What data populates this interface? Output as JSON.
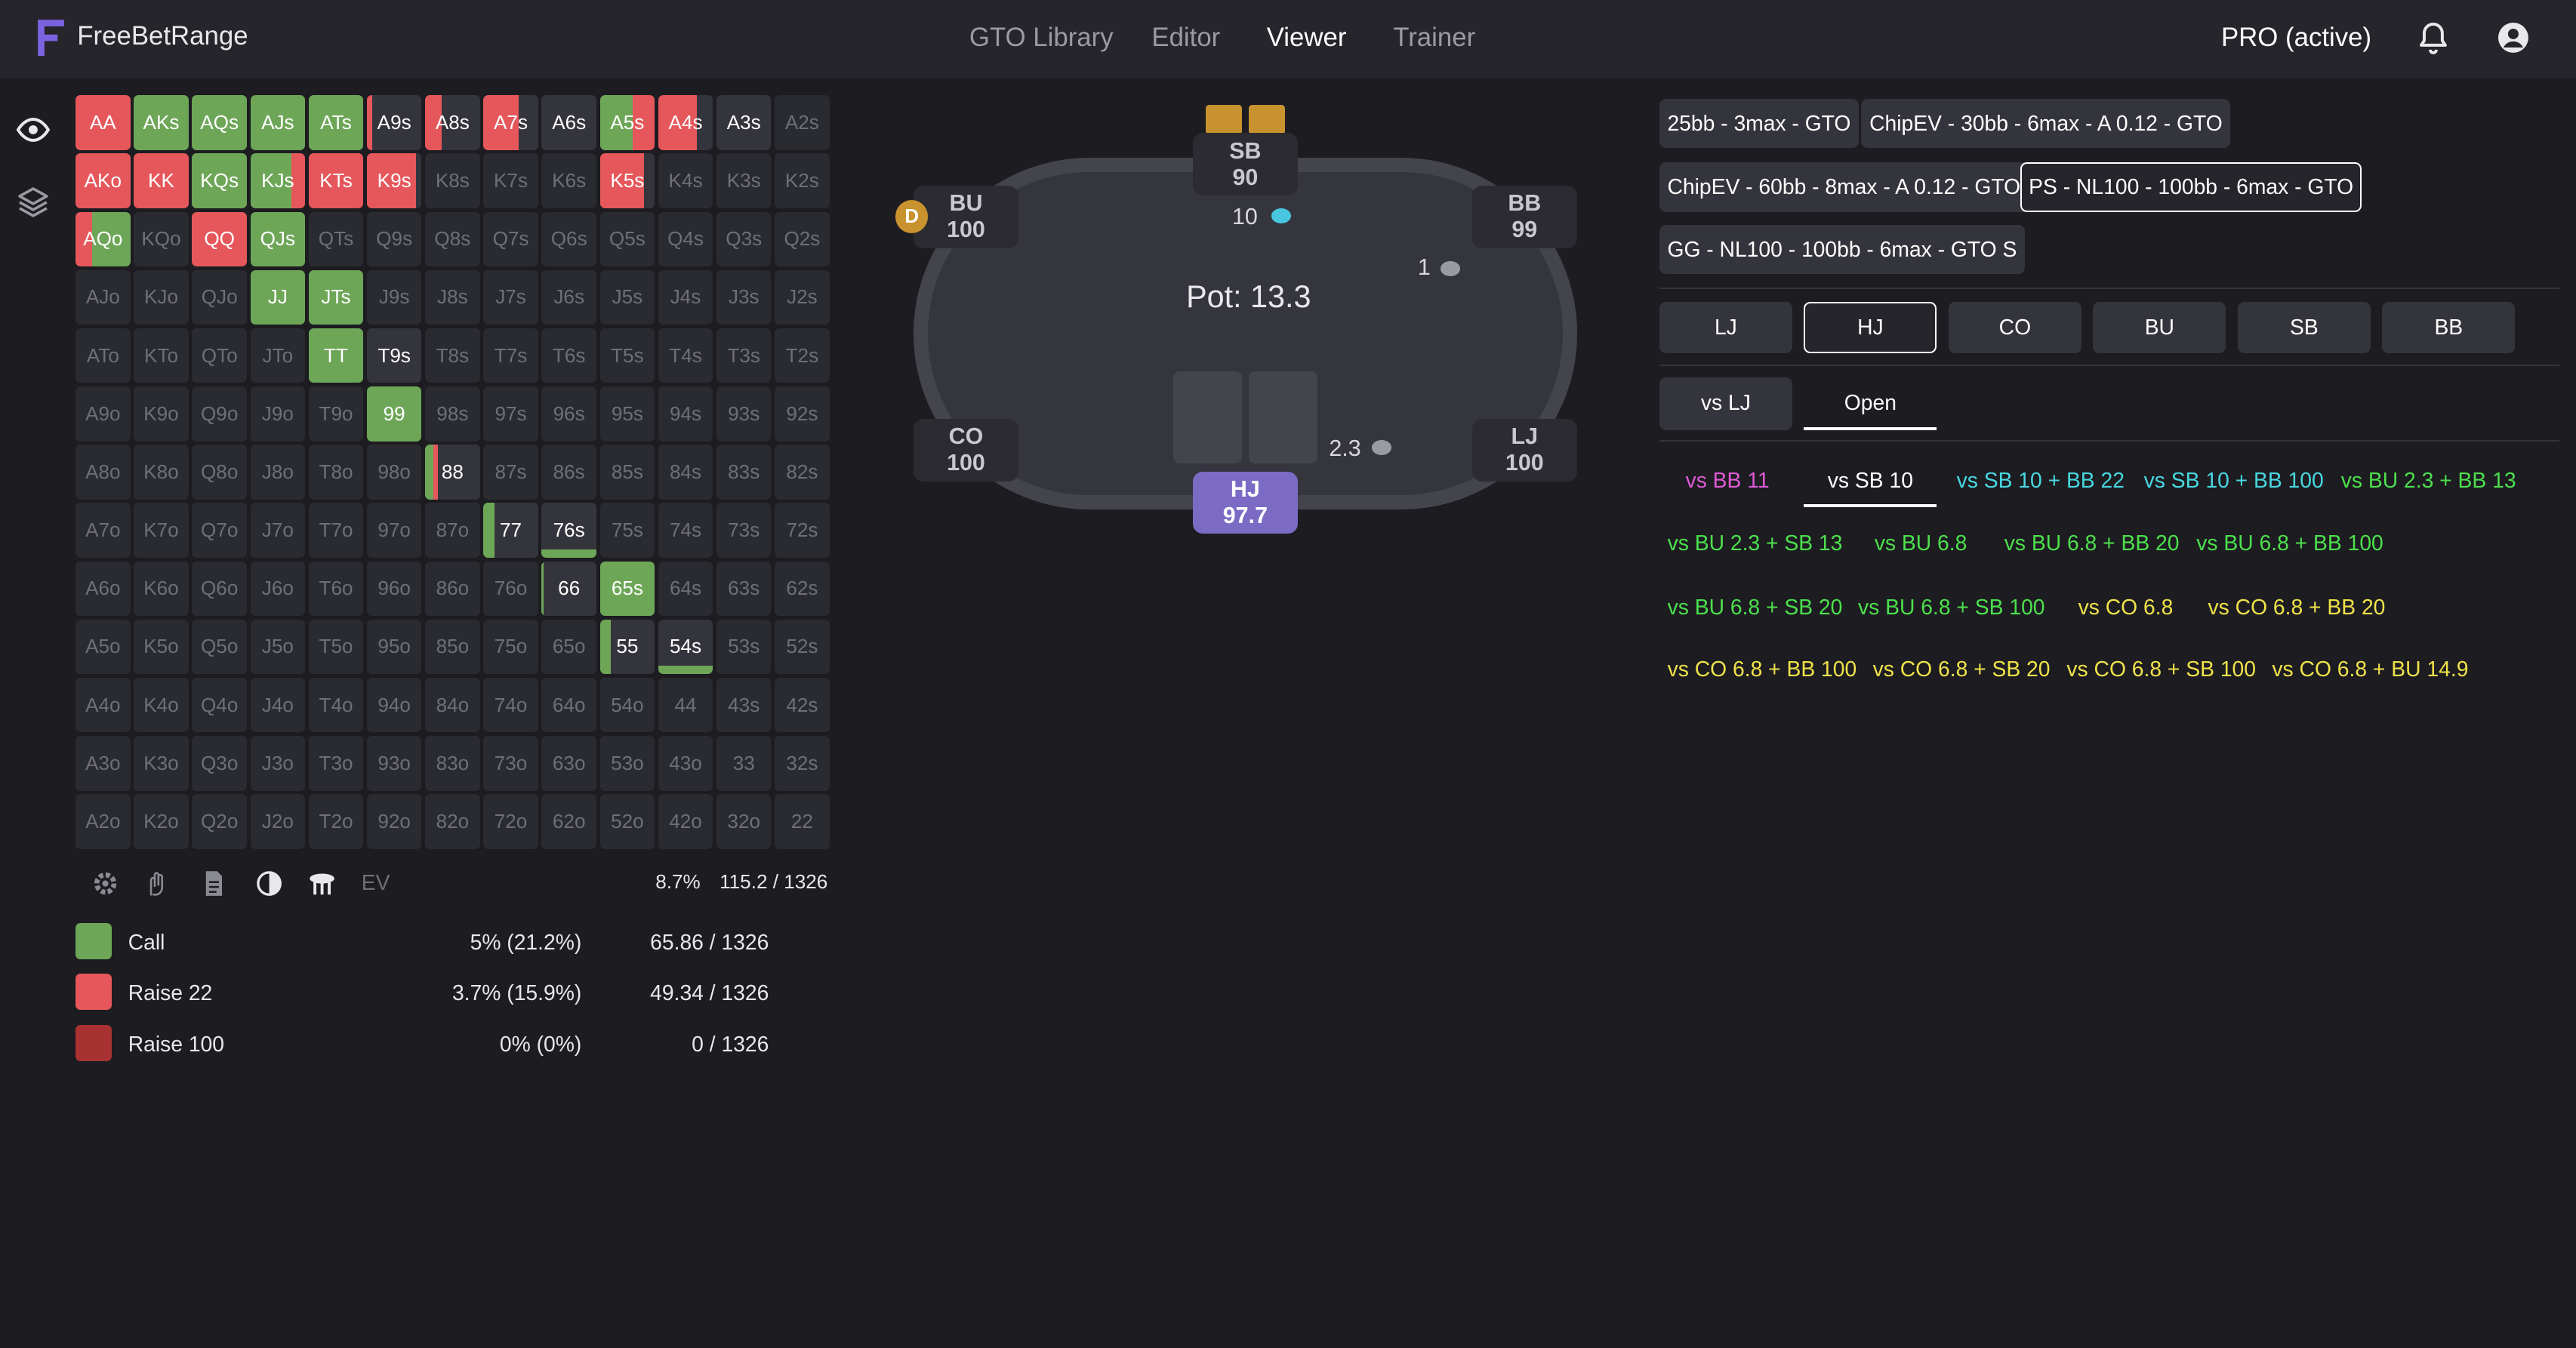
{
  "header": {
    "brand": "FreeBetRange",
    "nav": [
      "GTO Library",
      "Editor",
      "Viewer",
      "Trainer"
    ],
    "active_nav": "Viewer",
    "pro_status": "PRO (active)"
  },
  "rail": [
    "eye-icon",
    "layers-icon"
  ],
  "colors": {
    "call": "#6ea658",
    "raise22": "#e5575b",
    "raise100": "#a83232",
    "hero": "#7b6bc4",
    "dealer": "#c8922f"
  },
  "grid": [
    [
      [
        "AA",
        "mix",
        "raise22:1"
      ],
      [
        "AKs",
        "mix",
        "call:1"
      ],
      [
        "AQs",
        "mix",
        "call:1"
      ],
      [
        "AJs",
        "mix",
        "call:1"
      ],
      [
        "ATs",
        "mix",
        "call:1"
      ],
      [
        "A9s",
        "mix",
        "raise22:0.1,dark:0.9"
      ],
      [
        "A8s",
        "mix",
        "raise22:0.3,dark:0.7"
      ],
      [
        "A7s",
        "mix",
        "raise22:0.65,dark:0.35"
      ],
      [
        "A6s",
        "mix",
        "dark:1"
      ],
      [
        "A5s",
        "mix",
        "call:0.6,raise22:0.4"
      ],
      [
        "A4s",
        "mix",
        "raise22:0.7,dark:0.3"
      ],
      [
        "A3s",
        "mix",
        "dark:1"
      ],
      [
        "A2s",
        "off",
        ""
      ]
    ],
    [
      [
        "AKo",
        "mix",
        "raise22:1"
      ],
      [
        "KK",
        "mix",
        "raise22:1"
      ],
      [
        "KQs",
        "mix",
        "call:1"
      ],
      [
        "KJs",
        "mix",
        "call:0.75,raise22:0.25"
      ],
      [
        "KTs",
        "mix",
        "raise22:1"
      ],
      [
        "K9s",
        "mix",
        "raise22:0.9,dark:0.1"
      ],
      [
        "K8s",
        "off",
        ""
      ],
      [
        "K7s",
        "off",
        ""
      ],
      [
        "K6s",
        "off",
        ""
      ],
      [
        "K5s",
        "mix",
        "raise22:0.8,dark:0.2"
      ],
      [
        "K4s",
        "off",
        ""
      ],
      [
        "K3s",
        "off",
        ""
      ],
      [
        "K2s",
        "off",
        ""
      ]
    ],
    [
      [
        "AQo",
        "mix",
        "raise22:0.3,call:0.7"
      ],
      [
        "KQo",
        "off",
        ""
      ],
      [
        "QQ",
        "mix",
        "raise22:1"
      ],
      [
        "QJs",
        "mix",
        "call:1"
      ],
      [
        "QTs",
        "off",
        ""
      ],
      [
        "Q9s",
        "off",
        ""
      ],
      [
        "Q8s",
        "off",
        ""
      ],
      [
        "Q7s",
        "off",
        ""
      ],
      [
        "Q6s",
        "off",
        ""
      ],
      [
        "Q5s",
        "off",
        ""
      ],
      [
        "Q4s",
        "off",
        ""
      ],
      [
        "Q3s",
        "off",
        ""
      ],
      [
        "Q2s",
        "off",
        ""
      ]
    ],
    [
      [
        "AJo",
        "off",
        ""
      ],
      [
        "KJo",
        "off",
        ""
      ],
      [
        "QJo",
        "off",
        ""
      ],
      [
        "JJ",
        "mix",
        "call:1"
      ],
      [
        "JTs",
        "mix",
        "call:1"
      ],
      [
        "J9s",
        "off",
        ""
      ],
      [
        "J8s",
        "off",
        ""
      ],
      [
        "J7s",
        "off",
        ""
      ],
      [
        "J6s",
        "off",
        ""
      ],
      [
        "J5s",
        "off",
        ""
      ],
      [
        "J4s",
        "off",
        ""
      ],
      [
        "J3s",
        "off",
        ""
      ],
      [
        "J2s",
        "off",
        ""
      ]
    ],
    [
      [
        "ATo",
        "off",
        ""
      ],
      [
        "KTo",
        "off",
        ""
      ],
      [
        "QTo",
        "off",
        ""
      ],
      [
        "JTo",
        "off",
        ""
      ],
      [
        "TT",
        "mix",
        "call:1"
      ],
      [
        "T9s",
        "mix",
        "dark:1"
      ],
      [
        "T8s",
        "off",
        ""
      ],
      [
        "T7s",
        "off",
        ""
      ],
      [
        "T6s",
        "off",
        ""
      ],
      [
        "T5s",
        "off",
        ""
      ],
      [
        "T4s",
        "off",
        ""
      ],
      [
        "T3s",
        "off",
        ""
      ],
      [
        "T2s",
        "off",
        ""
      ]
    ],
    [
      [
        "A9o",
        "off",
        ""
      ],
      [
        "K9o",
        "off",
        ""
      ],
      [
        "Q9o",
        "off",
        ""
      ],
      [
        "J9o",
        "off",
        ""
      ],
      [
        "T9o",
        "off",
        ""
      ],
      [
        "99",
        "mix",
        "call:1"
      ],
      [
        "98s",
        "off",
        ""
      ],
      [
        "97s",
        "off",
        ""
      ],
      [
        "96s",
        "off",
        ""
      ],
      [
        "95s",
        "off",
        ""
      ],
      [
        "94s",
        "off",
        ""
      ],
      [
        "93s",
        "off",
        ""
      ],
      [
        "92s",
        "off",
        ""
      ]
    ],
    [
      [
        "A8o",
        "off",
        ""
      ],
      [
        "K8o",
        "off",
        ""
      ],
      [
        "Q8o",
        "off",
        ""
      ],
      [
        "J8o",
        "off",
        ""
      ],
      [
        "T8o",
        "off",
        ""
      ],
      [
        "98o",
        "off",
        ""
      ],
      [
        "88",
        "mix",
        "call:0.15,raise22:0.08,dark:0.77"
      ],
      [
        "87s",
        "off",
        ""
      ],
      [
        "86s",
        "off",
        ""
      ],
      [
        "85s",
        "off",
        ""
      ],
      [
        "84s",
        "off",
        ""
      ],
      [
        "83s",
        "off",
        ""
      ],
      [
        "82s",
        "off",
        ""
      ]
    ],
    [
      [
        "A7o",
        "off",
        ""
      ],
      [
        "K7o",
        "off",
        ""
      ],
      [
        "Q7o",
        "off",
        ""
      ],
      [
        "J7o",
        "off",
        ""
      ],
      [
        "T7o",
        "off",
        ""
      ],
      [
        "97o",
        "off",
        ""
      ],
      [
        "87o",
        "off",
        ""
      ],
      [
        "77",
        "mix",
        "call:0.2,dark:0.8"
      ],
      [
        "76s",
        "bar",
        "dark:1"
      ],
      [
        "75s",
        "off",
        ""
      ],
      [
        "74s",
        "off",
        ""
      ],
      [
        "73s",
        "off",
        ""
      ],
      [
        "72s",
        "off",
        ""
      ]
    ],
    [
      [
        "A6o",
        "off",
        ""
      ],
      [
        "K6o",
        "off",
        ""
      ],
      [
        "Q6o",
        "off",
        ""
      ],
      [
        "J6o",
        "off",
        ""
      ],
      [
        "T6o",
        "off",
        ""
      ],
      [
        "96o",
        "off",
        ""
      ],
      [
        "86o",
        "off",
        ""
      ],
      [
        "76o",
        "off",
        ""
      ],
      [
        "66",
        "mix",
        "call:0.03,dark:0.97"
      ],
      [
        "65s",
        "mix",
        "call:1"
      ],
      [
        "64s",
        "off",
        ""
      ],
      [
        "63s",
        "off",
        ""
      ],
      [
        "62s",
        "off",
        ""
      ]
    ],
    [
      [
        "A5o",
        "off",
        ""
      ],
      [
        "K5o",
        "off",
        ""
      ],
      [
        "Q5o",
        "off",
        ""
      ],
      [
        "J5o",
        "off",
        ""
      ],
      [
        "T5o",
        "off",
        ""
      ],
      [
        "95o",
        "off",
        ""
      ],
      [
        "85o",
        "off",
        ""
      ],
      [
        "75o",
        "off",
        ""
      ],
      [
        "65o",
        "off",
        ""
      ],
      [
        "55",
        "mix",
        "call:0.2,dark:0.8"
      ],
      [
        "54s",
        "bar",
        "dark:1"
      ],
      [
        "53s",
        "off",
        ""
      ],
      [
        "52s",
        "off",
        ""
      ]
    ],
    [
      [
        "A4o",
        "off",
        ""
      ],
      [
        "K4o",
        "off",
        ""
      ],
      [
        "Q4o",
        "off",
        ""
      ],
      [
        "J4o",
        "off",
        ""
      ],
      [
        "T4o",
        "off",
        ""
      ],
      [
        "94o",
        "off",
        ""
      ],
      [
        "84o",
        "off",
        ""
      ],
      [
        "74o",
        "off",
        ""
      ],
      [
        "64o",
        "off",
        ""
      ],
      [
        "54o",
        "off",
        ""
      ],
      [
        "44",
        "off",
        ""
      ],
      [
        "43s",
        "off",
        ""
      ],
      [
        "42s",
        "off",
        ""
      ]
    ],
    [
      [
        "A3o",
        "off",
        ""
      ],
      [
        "K3o",
        "off",
        ""
      ],
      [
        "Q3o",
        "off",
        ""
      ],
      [
        "J3o",
        "off",
        ""
      ],
      [
        "T3o",
        "off",
        ""
      ],
      [
        "93o",
        "off",
        ""
      ],
      [
        "83o",
        "off",
        ""
      ],
      [
        "73o",
        "off",
        ""
      ],
      [
        "63o",
        "off",
        ""
      ],
      [
        "53o",
        "off",
        ""
      ],
      [
        "43o",
        "off",
        ""
      ],
      [
        "33",
        "off",
        ""
      ],
      [
        "32s",
        "off",
        ""
      ]
    ],
    [
      [
        "A2o",
        "off",
        ""
      ],
      [
        "K2o",
        "off",
        ""
      ],
      [
        "Q2o",
        "off",
        ""
      ],
      [
        "J2o",
        "off",
        ""
      ],
      [
        "T2o",
        "off",
        ""
      ],
      [
        "92o",
        "off",
        ""
      ],
      [
        "82o",
        "off",
        ""
      ],
      [
        "72o",
        "off",
        ""
      ],
      [
        "62o",
        "off",
        ""
      ],
      [
        "52o",
        "off",
        ""
      ],
      [
        "42o",
        "off",
        ""
      ],
      [
        "32o",
        "off",
        ""
      ],
      [
        "22",
        "off",
        ""
      ]
    ]
  ],
  "grid_toolbar": {
    "icons": [
      "settings-icon",
      "hand-icon",
      "document-icon",
      "contrast-icon",
      "table-icon"
    ],
    "ev_label": "EV",
    "percent": "8.7%",
    "combos": "115.2 / 1326"
  },
  "legend": [
    {
      "name": "Call",
      "color": "#6ea658",
      "pct": "5% (21.2%)",
      "combos": "65.86 / 1326"
    },
    {
      "name": "Raise 22",
      "color": "#e5575b",
      "pct": "3.7% (15.9%)",
      "combos": "49.34 / 1326"
    },
    {
      "name": "Raise 100",
      "color": "#a83232",
      "pct": "0% (0%)",
      "combos": "0 / 1326"
    }
  ],
  "table": {
    "pot": "Pot: 13.3",
    "dealer": "D",
    "seats": {
      "sb": {
        "name": "SB",
        "stack": "90"
      },
      "bu": {
        "name": "BU",
        "stack": "100"
      },
      "bb": {
        "name": "BB",
        "stack": "99"
      },
      "co": {
        "name": "CO",
        "stack": "100"
      },
      "lj": {
        "name": "LJ",
        "stack": "100"
      },
      "hj": {
        "name": "HJ",
        "stack": "97.7"
      }
    },
    "bets": {
      "sb": "10",
      "bb": "1",
      "hj": "2.3"
    }
  },
  "presets": [
    "25bb - 3max - GTO",
    "ChipEV - 30bb - 6max - A 0.12 - GTO",
    "ChipEV - 60bb - 8max - A 0.12 - GTO",
    "PS - NL100 - 100bb - 6max - GTO",
    "GG - NL100 - 100bb - 6max - GTO S"
  ],
  "active_preset": "PS - NL100 - 100bb - 6max - GTO",
  "positions": [
    "LJ",
    "HJ",
    "CO",
    "BU",
    "SB",
    "BB"
  ],
  "active_position": "HJ",
  "filter_tabs": [
    "vs LJ",
    "Open"
  ],
  "scenarios": [
    {
      "label": "vs BB 11",
      "color": "#e05ad6"
    },
    {
      "label": "vs SB 10",
      "color": "#ffffff"
    },
    {
      "label": "vs SB 10 + BB 22",
      "color": "#49d8e0"
    },
    {
      "label": "vs SB 10 + BB 100",
      "color": "#49d8e0"
    },
    {
      "label": "vs BU 2.3 + BB 13",
      "color": "#4de04d"
    },
    {
      "label": "vs BU 2.3 + SB 13",
      "color": "#4de04d"
    },
    {
      "label": "vs BU 6.8",
      "color": "#4de04d"
    },
    {
      "label": "vs BU 6.8 + BB 20",
      "color": "#4de04d"
    },
    {
      "label": "vs BU 6.8 + BB 100",
      "color": "#4de04d"
    },
    {
      "label": "vs BU 6.8 + SB 20",
      "color": "#4de04d"
    },
    {
      "label": "vs BU 6.8 + SB 100",
      "color": "#4de04d"
    },
    {
      "label": "vs CO 6.8",
      "color": "#f0e24a"
    },
    {
      "label": "vs CO 6.8 + BB 20",
      "color": "#f0e24a"
    },
    {
      "label": "vs CO 6.8 + BB 100",
      "color": "#f0e24a"
    },
    {
      "label": "vs CO 6.8 + SB 20",
      "color": "#f0e24a"
    },
    {
      "label": "vs CO 6.8 + SB 100",
      "color": "#f0e24a"
    },
    {
      "label": "vs CO 6.8 + BU 14.9",
      "color": "#f0e24a"
    }
  ],
  "active_scenario": "vs SB 10"
}
